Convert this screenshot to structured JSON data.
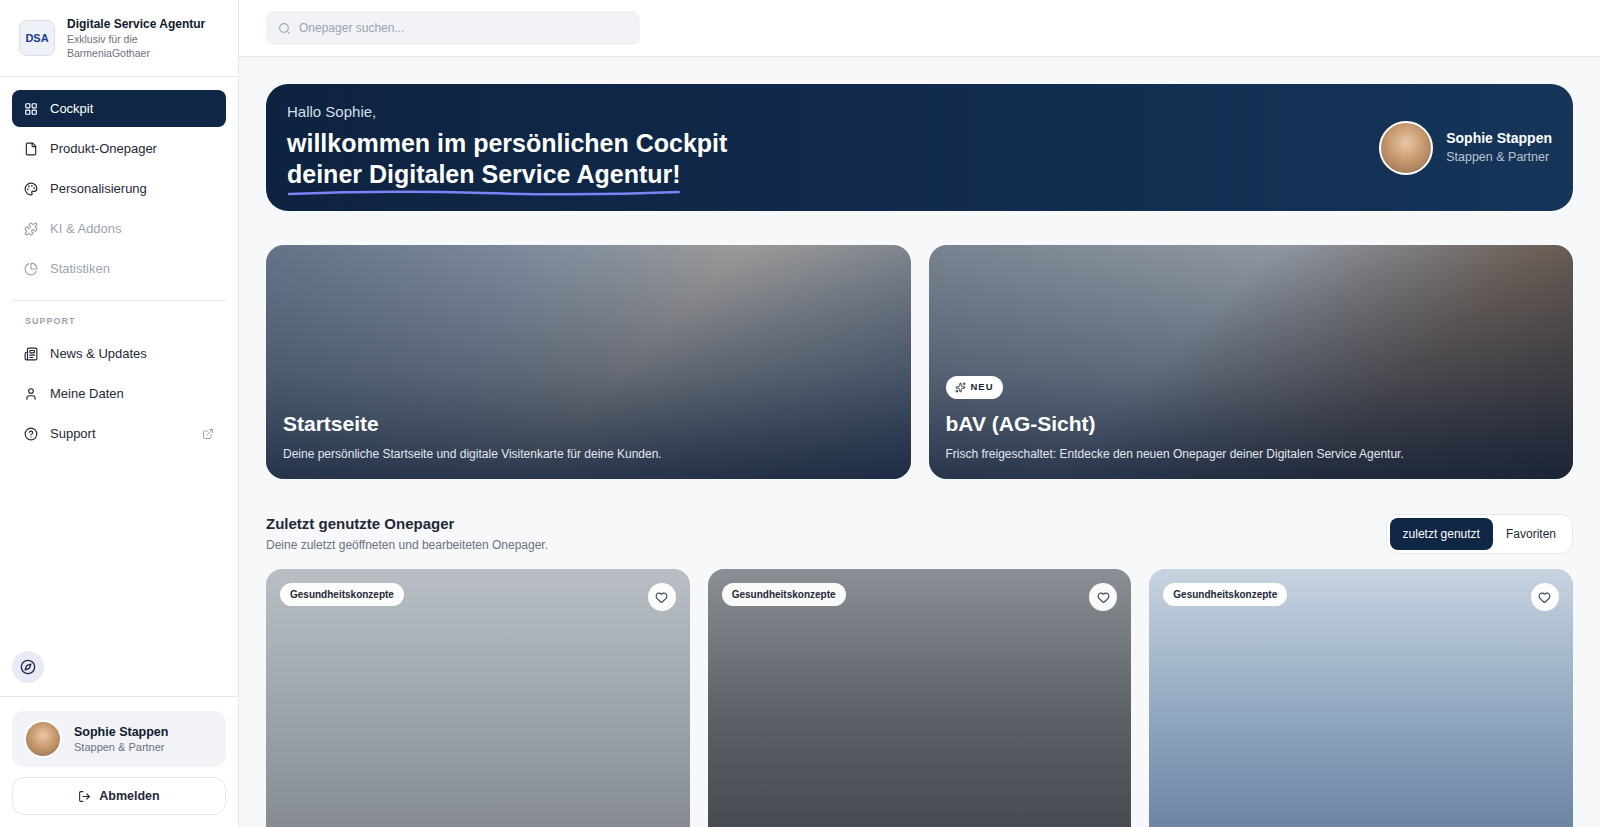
{
  "brand": {
    "logo": "DSA",
    "title": "Digitale Service Agentur",
    "subtitle": "Exklusiv für die BarmeniaGothaer"
  },
  "nav": [
    {
      "label": "Cockpit",
      "icon": "grid",
      "selected": true,
      "disabled": false
    },
    {
      "label": "Produkt-Onepager",
      "icon": "file",
      "selected": false,
      "disabled": false
    },
    {
      "label": "Personalisierung",
      "icon": "palette",
      "selected": false,
      "disabled": false
    },
    {
      "label": "KI & Addons",
      "icon": "puzzle",
      "selected": false,
      "disabled": true
    },
    {
      "label": "Statistiken",
      "icon": "chart",
      "selected": false,
      "disabled": true
    }
  ],
  "support_section": {
    "heading": "SUPPORT",
    "items": [
      {
        "label": "News & Updates",
        "icon": "news",
        "external": false
      },
      {
        "label": "Meine Daten",
        "icon": "user",
        "external": false
      },
      {
        "label": "Support",
        "icon": "help",
        "external": true
      }
    ]
  },
  "user": {
    "name": "Sophie Stappen",
    "company": "Stappen & Partner"
  },
  "logout": "Abmelden",
  "search": {
    "placeholder": "Onepager suchen..."
  },
  "welcome": {
    "greeting": "Hallo Sophie,",
    "line1": "willkommen im persönlichen Cockpit",
    "line2": "deiner Digitalen Service Agentur!"
  },
  "features": [
    {
      "title": "Startseite",
      "description": "Deine persönliche Startseite und digitale Visitenkarte für deine Kunden.",
      "badge": ""
    },
    {
      "title": "bAV (AG-Sicht)",
      "description": "Frisch freigeschaltet: Entdecke den neuen Onepager deiner Digitalen Service Agentur.",
      "badge": "NEU"
    }
  ],
  "recent": {
    "title": "Zuletzt genutzte Onepager",
    "subtitle": "Deine zuletzt geöffneten und bearbeiteten Onepager.",
    "toggle": [
      {
        "label": "zuletzt genutzt",
        "selected": true
      },
      {
        "label": "Favoriten",
        "selected": false
      }
    ],
    "cards": [
      {
        "tag": "Gesundheitskonzepte",
        "favorite": false
      },
      {
        "tag": "Gesundheitskonzepte",
        "favorite": false
      },
      {
        "tag": "Gesundheitskonzepte",
        "favorite": false
      }
    ]
  }
}
